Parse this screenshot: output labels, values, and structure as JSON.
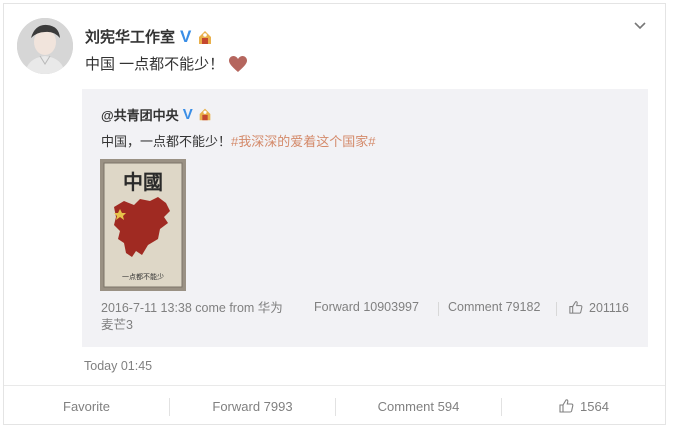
{
  "post": {
    "author": "刘宪华工作室",
    "text": "中国 一点都不能少！",
    "heart_icon": "heart-icon",
    "timestamp": "Today 01:45"
  },
  "repost": {
    "author": "@共青团中央",
    "text_plain": "中国，一点都不能少！",
    "hashtag": "#我深深的爱着这个国家#",
    "image_title": "中國",
    "image_caption": "一点都不能少",
    "source_line1": "2016-7-11 13:38 come from 华为",
    "source_line2": "麦芒3",
    "forward": "Forward 10903997",
    "comment": "Comment 79182",
    "likes": "201116"
  },
  "actions": {
    "favorite": "Favorite",
    "forward": "Forward 7993",
    "comment": "Comment 594",
    "likes": "1564"
  },
  "colors": {
    "verified": "#3a8ee6",
    "hashtag": "#d48a6a",
    "heart": "#b5665e",
    "repost_bg": "#f2f2f5"
  }
}
